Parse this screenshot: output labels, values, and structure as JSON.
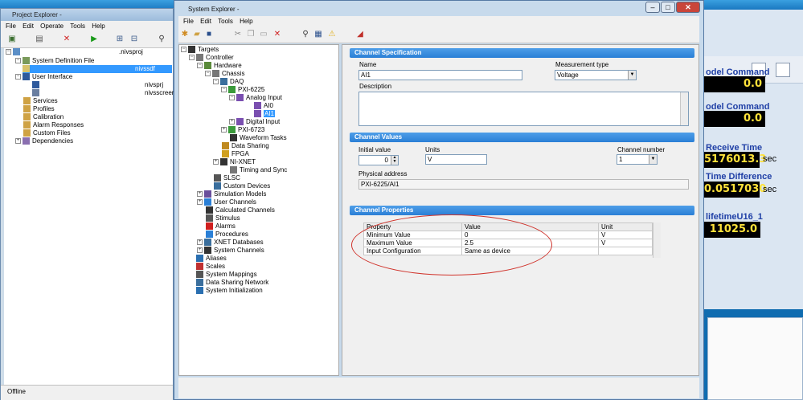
{
  "project_explorer": {
    "title": "Project Explorer -",
    "menu": [
      "File",
      "Edit",
      "Operate",
      "Tools",
      "Help"
    ],
    "tree": [
      {
        "label": ".nivsproj",
        "extra": ""
      },
      {
        "label": "System Definition File",
        "extra": ""
      },
      {
        "label": "",
        "extra": "nivssdf"
      },
      {
        "label": "User Interface",
        "extra": ""
      },
      {
        "label": "",
        "extra": "nivsprj"
      },
      {
        "label": "",
        "extra": "nivsscreen"
      },
      {
        "label": "Services",
        "extra": ""
      },
      {
        "label": "Profiles",
        "extra": ""
      },
      {
        "label": "Calibration",
        "extra": ""
      },
      {
        "label": "Alarm Responses",
        "extra": ""
      },
      {
        "label": "Custom Files",
        "extra": ""
      },
      {
        "label": "Dependencies",
        "extra": ""
      }
    ],
    "status": "Offline"
  },
  "system_explorer": {
    "title": "System Explorer -",
    "menu": [
      "File",
      "Edit",
      "Tools",
      "Help"
    ],
    "tree": [
      "Targets",
      "Controller",
      "Hardware",
      "Chassis",
      "DAQ",
      "PXI-6225",
      "Analog Input",
      "AI0",
      "AI1",
      "Digital Input",
      "PXI-6723",
      "Waveform Tasks",
      "Data Sharing",
      "FPGA",
      "NI-XNET",
      "Timing and Sync",
      "SLSC",
      "Custom Devices",
      "Simulation Models",
      "User Channels",
      "Calculated Channels",
      "Stimulus",
      "Alarms",
      "Procedures",
      "XNET Databases",
      "System Channels",
      "Aliases",
      "Scales",
      "System Mappings",
      "Data Sharing Network",
      "System Initialization"
    ]
  },
  "channel_spec": {
    "header": "Channel Specification",
    "name_label": "Name",
    "name_value": "AI1",
    "mtype_label": "Measurement type",
    "mtype_value": "Voltage",
    "desc_label": "Description"
  },
  "channel_values": {
    "header": "Channel Values",
    "initial_label": "Initial value",
    "initial_value": "0",
    "units_label": "Units",
    "units_value": "V",
    "chnum_label": "Channel number",
    "chnum_value": "1",
    "phys_label": "Physical address",
    "phys_value": "PXI-6225/AI1"
  },
  "channel_props": {
    "header": "Channel Properties",
    "columns": [
      "Property",
      "Value",
      "Unit"
    ],
    "rows": [
      [
        "Minimum Value",
        "0",
        "V"
      ],
      [
        "Maximum Value",
        "2.5",
        "V"
      ],
      [
        "Input Configuration",
        "Same as device",
        ""
      ]
    ]
  },
  "right_panel": {
    "labels": [
      "odel Command",
      "odel Command",
      "Receive Time",
      "Time Difference",
      "lifetimeU16_1"
    ],
    "values": [
      "0.0",
      "0.0",
      "5176013.3",
      "0.0517030",
      "11025.0"
    ],
    "units": [
      "",
      "",
      "sec",
      "sec",
      ""
    ]
  },
  "colors": {
    "section_header": "#2a7fd6",
    "indicator_bg": "#000000",
    "indicator_fg": "#ffe23a",
    "annotation_ellipse": "#d0332b"
  }
}
